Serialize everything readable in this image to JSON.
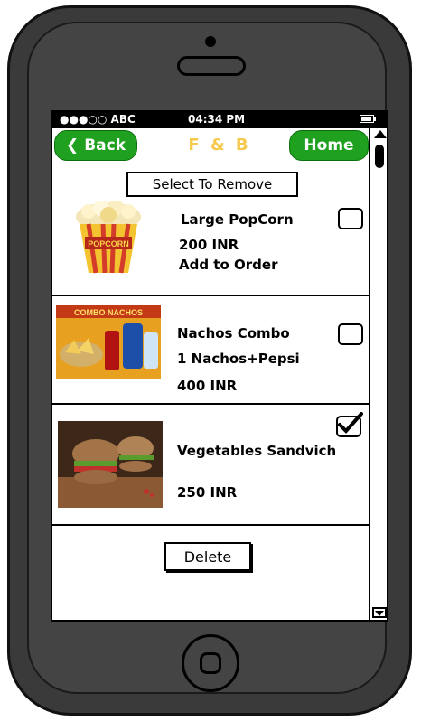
{
  "statusbar": {
    "carrier": "●●●○○ ABC",
    "time": "04:34 PM"
  },
  "nav": {
    "back_label": "Back",
    "title": "F & B",
    "home_label": "Home"
  },
  "content": {
    "select_label": "Select To Remove",
    "items": [
      {
        "name": "Large PopCorn",
        "line2": "200 INR",
        "line3": "Add to Order",
        "checked": false
      },
      {
        "name": "Nachos Combo",
        "line2": "1 Nachos+Pepsi",
        "line3": "400 INR",
        "checked": false
      },
      {
        "name": "Vegetables Sandvich",
        "line2": "250 INR",
        "checked": true
      }
    ],
    "delete_label": "Delete",
    "combo_image_text": "COMBO NACHOS"
  },
  "colors": {
    "nav_button": "#1fa11f",
    "title": "#f6c94a",
    "phone_body": "#3a3a3a"
  }
}
